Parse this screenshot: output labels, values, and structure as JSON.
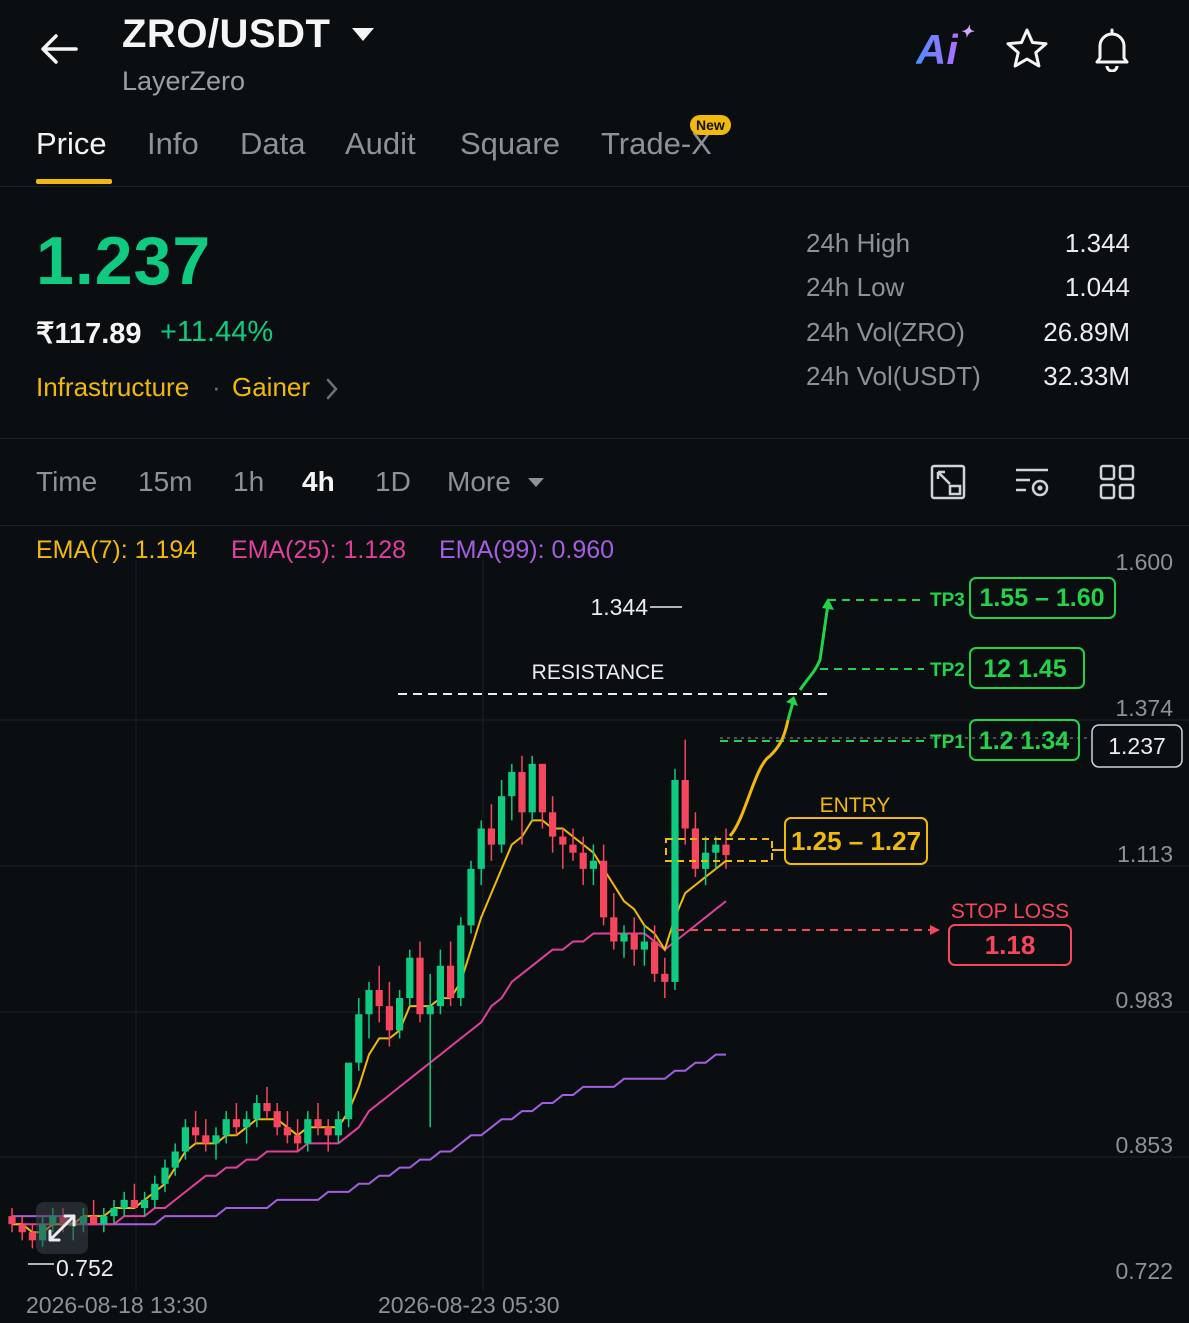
{
  "header": {
    "pair": "ZRO/USDT",
    "name": "LayerZero",
    "ai_label": "Ai"
  },
  "tabs": [
    {
      "label": "Price",
      "active": true
    },
    {
      "label": "Info"
    },
    {
      "label": "Data"
    },
    {
      "label": "Audit"
    },
    {
      "label": "Square"
    },
    {
      "label": "Trade-X",
      "badge": "New"
    }
  ],
  "price": {
    "last": "1.237",
    "fiat": "₹117.89",
    "change": "+11.44%",
    "tag_category": "Infrastructure",
    "tag_status": "Gainer"
  },
  "stats": [
    {
      "label": "24h High",
      "value": "1.344"
    },
    {
      "label": "24h Low",
      "value": "1.044"
    },
    {
      "label": "24h Vol(ZRO)",
      "value": "26.89M"
    },
    {
      "label": "24h Vol(USDT)",
      "value": "32.33M"
    }
  ],
  "timeframes": {
    "label": "Time",
    "options": [
      "15m",
      "1h",
      "4h",
      "1D"
    ],
    "active": "4h",
    "more": "More"
  },
  "ema": [
    {
      "label": "EMA(7): 1.194",
      "color": "#f0b90b"
    },
    {
      "label": "EMA(25): 1.128",
      "color": "#e0409b"
    },
    {
      "label": "EMA(99): 0.960",
      "color": "#a55ee0"
    }
  ],
  "colors": {
    "up": "#0ecb81",
    "down": "#f6465d",
    "accent": "#f0b90b",
    "target": "#22d34a",
    "stop": "#f6465d"
  },
  "chart_data": {
    "type": "candlestick",
    "y_ticks": [
      "1.600",
      "1.374",
      "1.113",
      "0.983",
      "0.853",
      "0.722"
    ],
    "x_ticks": [
      "2026-08-18 13:30",
      "2026-08-23 05:30"
    ],
    "current_price_label": "1.237",
    "high_label": "1.344",
    "low_label": "0.752",
    "candles": [
      [
        0.79,
        0.8,
        0.77,
        0.78
      ],
      [
        0.78,
        0.79,
        0.76,
        0.77
      ],
      [
        0.77,
        0.78,
        0.75,
        0.76
      ],
      [
        0.76,
        0.79,
        0.752,
        0.78
      ],
      [
        0.78,
        0.8,
        0.77,
        0.79
      ],
      [
        0.79,
        0.8,
        0.77,
        0.78
      ],
      [
        0.78,
        0.79,
        0.76,
        0.78
      ],
      [
        0.78,
        0.8,
        0.77,
        0.79
      ],
      [
        0.79,
        0.81,
        0.78,
        0.78
      ],
      [
        0.78,
        0.8,
        0.77,
        0.79
      ],
      [
        0.79,
        0.81,
        0.78,
        0.8
      ],
      [
        0.8,
        0.82,
        0.79,
        0.81
      ],
      [
        0.81,
        0.83,
        0.8,
        0.8
      ],
      [
        0.8,
        0.82,
        0.79,
        0.81
      ],
      [
        0.81,
        0.84,
        0.8,
        0.83
      ],
      [
        0.83,
        0.86,
        0.82,
        0.85
      ],
      [
        0.85,
        0.88,
        0.84,
        0.87
      ],
      [
        0.87,
        0.91,
        0.86,
        0.9
      ],
      [
        0.9,
        0.92,
        0.88,
        0.89
      ],
      [
        0.89,
        0.91,
        0.87,
        0.88
      ],
      [
        0.88,
        0.9,
        0.86,
        0.89
      ],
      [
        0.89,
        0.92,
        0.88,
        0.91
      ],
      [
        0.91,
        0.93,
        0.89,
        0.9
      ],
      [
        0.9,
        0.92,
        0.88,
        0.91
      ],
      [
        0.91,
        0.94,
        0.9,
        0.93
      ],
      [
        0.93,
        0.95,
        0.91,
        0.92
      ],
      [
        0.92,
        0.93,
        0.89,
        0.9
      ],
      [
        0.9,
        0.92,
        0.88,
        0.89
      ],
      [
        0.89,
        0.91,
        0.87,
        0.88
      ],
      [
        0.88,
        0.92,
        0.87,
        0.91
      ],
      [
        0.91,
        0.93,
        0.89,
        0.9
      ],
      [
        0.9,
        0.91,
        0.87,
        0.89
      ],
      [
        0.89,
        0.92,
        0.88,
        0.91
      ],
      [
        0.91,
        0.95,
        0.9,
        0.98
      ],
      [
        0.98,
        1.06,
        0.97,
        1.04
      ],
      [
        1.04,
        1.08,
        1.01,
        1.07
      ],
      [
        1.07,
        1.1,
        1.03,
        1.05
      ],
      [
        1.05,
        1.08,
        1.0,
        1.02
      ],
      [
        1.02,
        1.07,
        1.01,
        1.06
      ],
      [
        1.06,
        1.12,
        1.05,
        1.11
      ],
      [
        1.11,
        1.13,
        1.03,
        1.04
      ],
      [
        1.04,
        1.09,
        0.9,
        1.05
      ],
      [
        1.05,
        1.12,
        1.04,
        1.1
      ],
      [
        1.1,
        1.13,
        1.05,
        1.06
      ],
      [
        1.06,
        1.16,
        1.05,
        1.15
      ],
      [
        1.15,
        1.23,
        1.14,
        1.22
      ],
      [
        1.22,
        1.28,
        1.2,
        1.27
      ],
      [
        1.27,
        1.3,
        1.23,
        1.25
      ],
      [
        1.25,
        1.33,
        1.24,
        1.31
      ],
      [
        1.31,
        1.35,
        1.28,
        1.34
      ],
      [
        1.34,
        1.36,
        1.25,
        1.29
      ],
      [
        1.29,
        1.36,
        1.28,
        1.35
      ],
      [
        1.35,
        1.35,
        1.27,
        1.29
      ],
      [
        1.29,
        1.31,
        1.24,
        1.26
      ],
      [
        1.26,
        1.27,
        1.22,
        1.25
      ],
      [
        1.25,
        1.27,
        1.23,
        1.24
      ],
      [
        1.24,
        1.26,
        1.2,
        1.22
      ],
      [
        1.22,
        1.25,
        1.2,
        1.23
      ],
      [
        1.23,
        1.25,
        1.15,
        1.16
      ],
      [
        1.16,
        1.19,
        1.12,
        1.13
      ],
      [
        1.13,
        1.15,
        1.11,
        1.14
      ],
      [
        1.14,
        1.16,
        1.1,
        1.12
      ],
      [
        1.12,
        1.15,
        1.1,
        1.13
      ],
      [
        1.13,
        1.15,
        1.08,
        1.09
      ],
      [
        1.09,
        1.11,
        1.06,
        1.08
      ],
      [
        1.08,
        1.344,
        1.07,
        1.33
      ],
      [
        1.33,
        1.38,
        1.25,
        1.27
      ],
      [
        1.27,
        1.29,
        1.21,
        1.22
      ],
      [
        1.22,
        1.26,
        1.2,
        1.24
      ],
      [
        1.24,
        1.26,
        1.22,
        1.25
      ],
      [
        1.25,
        1.27,
        1.22,
        1.237
      ]
    ],
    "ema7": [
      0.78,
      0.78,
      0.77,
      0.77,
      0.78,
      0.78,
      0.78,
      0.79,
      0.79,
      0.79,
      0.8,
      0.8,
      0.8,
      0.81,
      0.82,
      0.83,
      0.85,
      0.87,
      0.88,
      0.88,
      0.88,
      0.89,
      0.89,
      0.9,
      0.91,
      0.91,
      0.91,
      0.9,
      0.89,
      0.9,
      0.9,
      0.9,
      0.9,
      0.92,
      0.95,
      0.99,
      1.01,
      1.01,
      1.02,
      1.05,
      1.05,
      1.05,
      1.06,
      1.06,
      1.08,
      1.12,
      1.16,
      1.19,
      1.22,
      1.25,
      1.26,
      1.28,
      1.28,
      1.27,
      1.27,
      1.26,
      1.25,
      1.24,
      1.22,
      1.2,
      1.18,
      1.17,
      1.15,
      1.14,
      1.12,
      1.16,
      1.19,
      1.2,
      1.21,
      1.22,
      1.23
    ],
    "ema25": [
      0.78,
      0.78,
      0.78,
      0.78,
      0.78,
      0.78,
      0.78,
      0.78,
      0.78,
      0.78,
      0.78,
      0.79,
      0.79,
      0.79,
      0.8,
      0.8,
      0.81,
      0.82,
      0.83,
      0.84,
      0.84,
      0.85,
      0.85,
      0.86,
      0.86,
      0.87,
      0.87,
      0.87,
      0.87,
      0.88,
      0.88,
      0.88,
      0.88,
      0.89,
      0.9,
      0.92,
      0.93,
      0.94,
      0.95,
      0.96,
      0.97,
      0.98,
      0.99,
      1.0,
      1.01,
      1.02,
      1.03,
      1.05,
      1.06,
      1.08,
      1.09,
      1.1,
      1.11,
      1.12,
      1.12,
      1.13,
      1.13,
      1.14,
      1.14,
      1.14,
      1.14,
      1.14,
      1.14,
      1.13,
      1.12,
      1.13,
      1.14,
      1.15,
      1.16,
      1.17,
      1.18
    ],
    "ema99": [
      0.79,
      0.79,
      0.79,
      0.79,
      0.79,
      0.79,
      0.78,
      0.78,
      0.78,
      0.78,
      0.78,
      0.78,
      0.78,
      0.78,
      0.78,
      0.79,
      0.79,
      0.79,
      0.79,
      0.79,
      0.79,
      0.8,
      0.8,
      0.8,
      0.8,
      0.8,
      0.81,
      0.81,
      0.81,
      0.81,
      0.81,
      0.82,
      0.82,
      0.82,
      0.83,
      0.83,
      0.84,
      0.84,
      0.85,
      0.85,
      0.86,
      0.86,
      0.87,
      0.87,
      0.88,
      0.89,
      0.89,
      0.9,
      0.91,
      0.91,
      0.92,
      0.92,
      0.93,
      0.93,
      0.94,
      0.94,
      0.95,
      0.95,
      0.95,
      0.95,
      0.96,
      0.96,
      0.96,
      0.96,
      0.96,
      0.97,
      0.97,
      0.98,
      0.98,
      0.99,
      0.99
    ],
    "annotations": {
      "resistance": "RESISTANCE",
      "entry_label": "ENTRY",
      "entry_range": "1.25 – 1.27",
      "stop_label": "STOP LOSS",
      "stop_value": "1.18",
      "tp1_label": "TP1",
      "tp1_value": "1.2 1.34",
      "tp2_label": "TP2",
      "tp2_value": "12 1.45",
      "tp3_label": "TP3",
      "tp3_value": "1.55 – 1.60"
    }
  }
}
